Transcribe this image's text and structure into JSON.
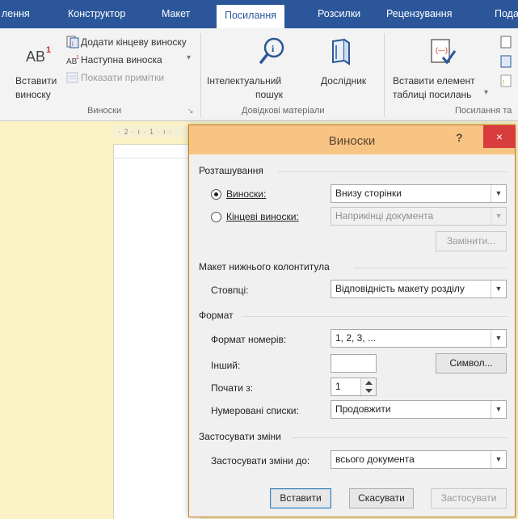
{
  "ribbon_tabs": [
    "лення",
    "Конструктор",
    "Макет",
    "Посилання",
    "Розсилки",
    "Рецензування",
    "Пода"
  ],
  "active_tab_index": 3,
  "ribbon": {
    "insert_footnote": [
      "Вставити",
      "виноску"
    ],
    "add_endnote": "Додати кінцеву виноску",
    "next_footnote": "Наступна виноска",
    "show_notes": "Показати примітки",
    "group_footnotes": "Виноски",
    "smart_lookup": [
      "Інтелектуальний",
      "пошук"
    ],
    "researcher": "Дослідник",
    "group_research": "Довідкові матеріали",
    "insert_table_of_authorities": [
      "Вставити елемент",
      "таблиці посилань"
    ],
    "group_authorities": "Посилання та"
  },
  "ruler_text": "· 2 · ı · 1 · ı ·",
  "dialog": {
    "title": "Виноски",
    "help": "?",
    "close": "×",
    "section_location": "Розташування",
    "footnotes_label": "Виноски:",
    "footnotes_value": "Внизу сторінки",
    "endnotes_label": "Кінцеві виноски:",
    "endnotes_value": "Наприкінці документа",
    "convert_button": "Замінити...",
    "section_layout": "Макет нижнього колонтитула",
    "columns_label": "Стовпці:",
    "columns_value": "Відповідність макету розділу",
    "section_format": "Формат",
    "number_format_label": "Формат номерів:",
    "number_format_value": "1, 2, 3, ...",
    "custom_mark_label": "Інший:",
    "custom_mark_value": "",
    "symbol_button": "Символ...",
    "start_at_label": "Почати з:",
    "start_at_value": "1",
    "numbering_label": "Нумеровані списки:",
    "numbering_value": "Продовжити",
    "section_apply": "Застосувати зміни",
    "apply_to_label": "Застосувати зміни до:",
    "apply_to_value": "всього документа",
    "insert_button": "Вставити",
    "cancel_button": "Скасувати",
    "apply_button": "Застосувати"
  },
  "colors": {
    "ribbon_blue": "#2b579a",
    "dialog_title": "#f7c483",
    "close_red": "#d83c3c",
    "background": "#fbf3c6"
  }
}
